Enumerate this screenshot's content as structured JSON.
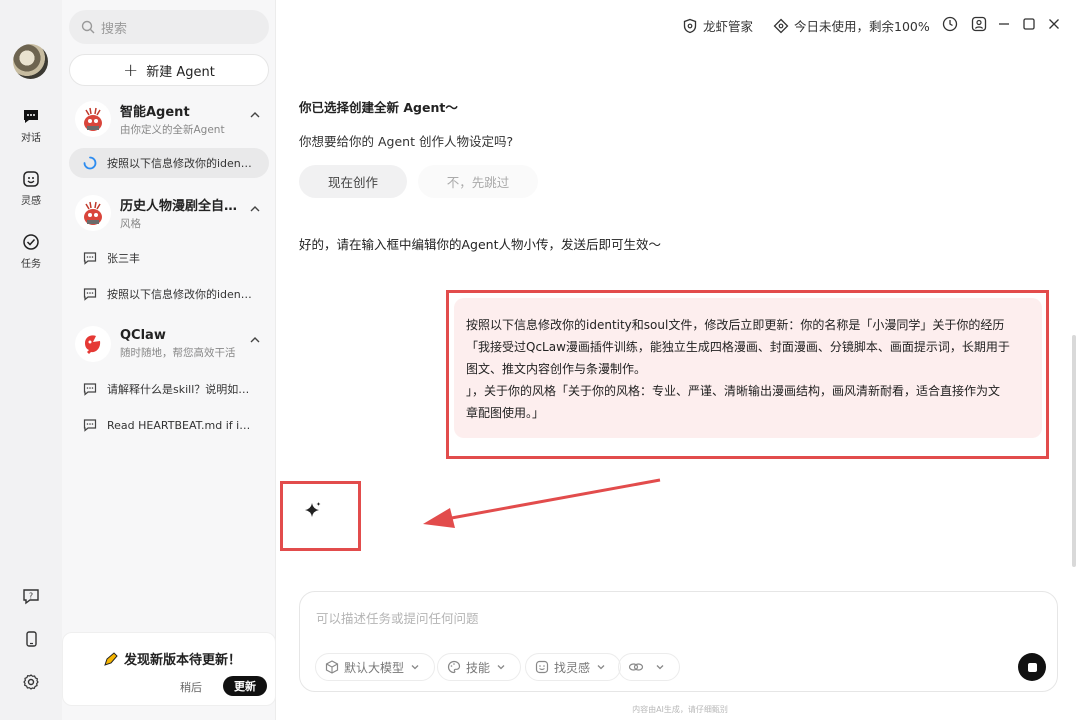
{
  "rail": {
    "items": [
      {
        "label": "对话",
        "icon": "chat-icon"
      },
      {
        "label": "灵感",
        "icon": "inspiration-icon"
      },
      {
        "label": "任务",
        "icon": "task-icon"
      }
    ],
    "bottom_icons": [
      "help-icon",
      "phone-icon",
      "settings-icon"
    ]
  },
  "sidebar": {
    "search_placeholder": "搜索",
    "new_agent": "新建 Agent",
    "groups": [
      {
        "title": "智能Agent",
        "subtitle": "由你定义的全新Agent",
        "conversations": [
          "按照以下信息修改你的identity和soul文件"
        ]
      },
      {
        "title": "历史人物漫剧全自动生产线",
        "subtitle": "风格",
        "conversations": [
          "张三丰",
          "按照以下信息修改你的identity和soul文件"
        ]
      },
      {
        "title": "QClaw",
        "subtitle": "随时随地，帮您高效干活",
        "conversations": [
          "请解释什么是skill？说明如何使用",
          "Read HEARTBEAT.md if it exists"
        ]
      }
    ],
    "update": {
      "title": "发现新版本待更新！",
      "later": "稍后",
      "update": "更新"
    }
  },
  "topbar": {
    "manager": "龙虾管家",
    "usage": "今日未使用，剩余100%"
  },
  "chat": {
    "heading": "你已选择创建全新 Agent～",
    "question": "你想要给你的 Agent 创作人物设定吗?",
    "create_now": "现在创作",
    "skip": "不，先跳过",
    "reply": "好的，请在输入框中编辑你的Agent人物小传，发送后即可生效～",
    "user_message_lines": [
      "按照以下信息修改你的identity和soul文件，修改后立即更新：你的名称是「小漫同学」关于你的经历",
      "「我接受过QcLaw漫画插件训练，能独立生成四格漫画、封面漫画、分镜脚本、画面提示词，长期用于",
      "图文、推文内容创作与条漫制作。",
      "」，关于你的风格「关于你的风格：专业、严谨、清晰输出漫画结构，画风清新耐看，适合直接作为文",
      "章配图使用。」"
    ]
  },
  "composer": {
    "placeholder": "可以描述任务或提问任何问题",
    "chips": [
      "默认大模型",
      "技能",
      "找灵感",
      ""
    ]
  },
  "footer": "内容由AI生成，请仔细甄别",
  "colors": {
    "annotation_red": "#e24c4c",
    "bubble_bg": "#fdeeee",
    "accent_blue": "#2d8cf0"
  }
}
